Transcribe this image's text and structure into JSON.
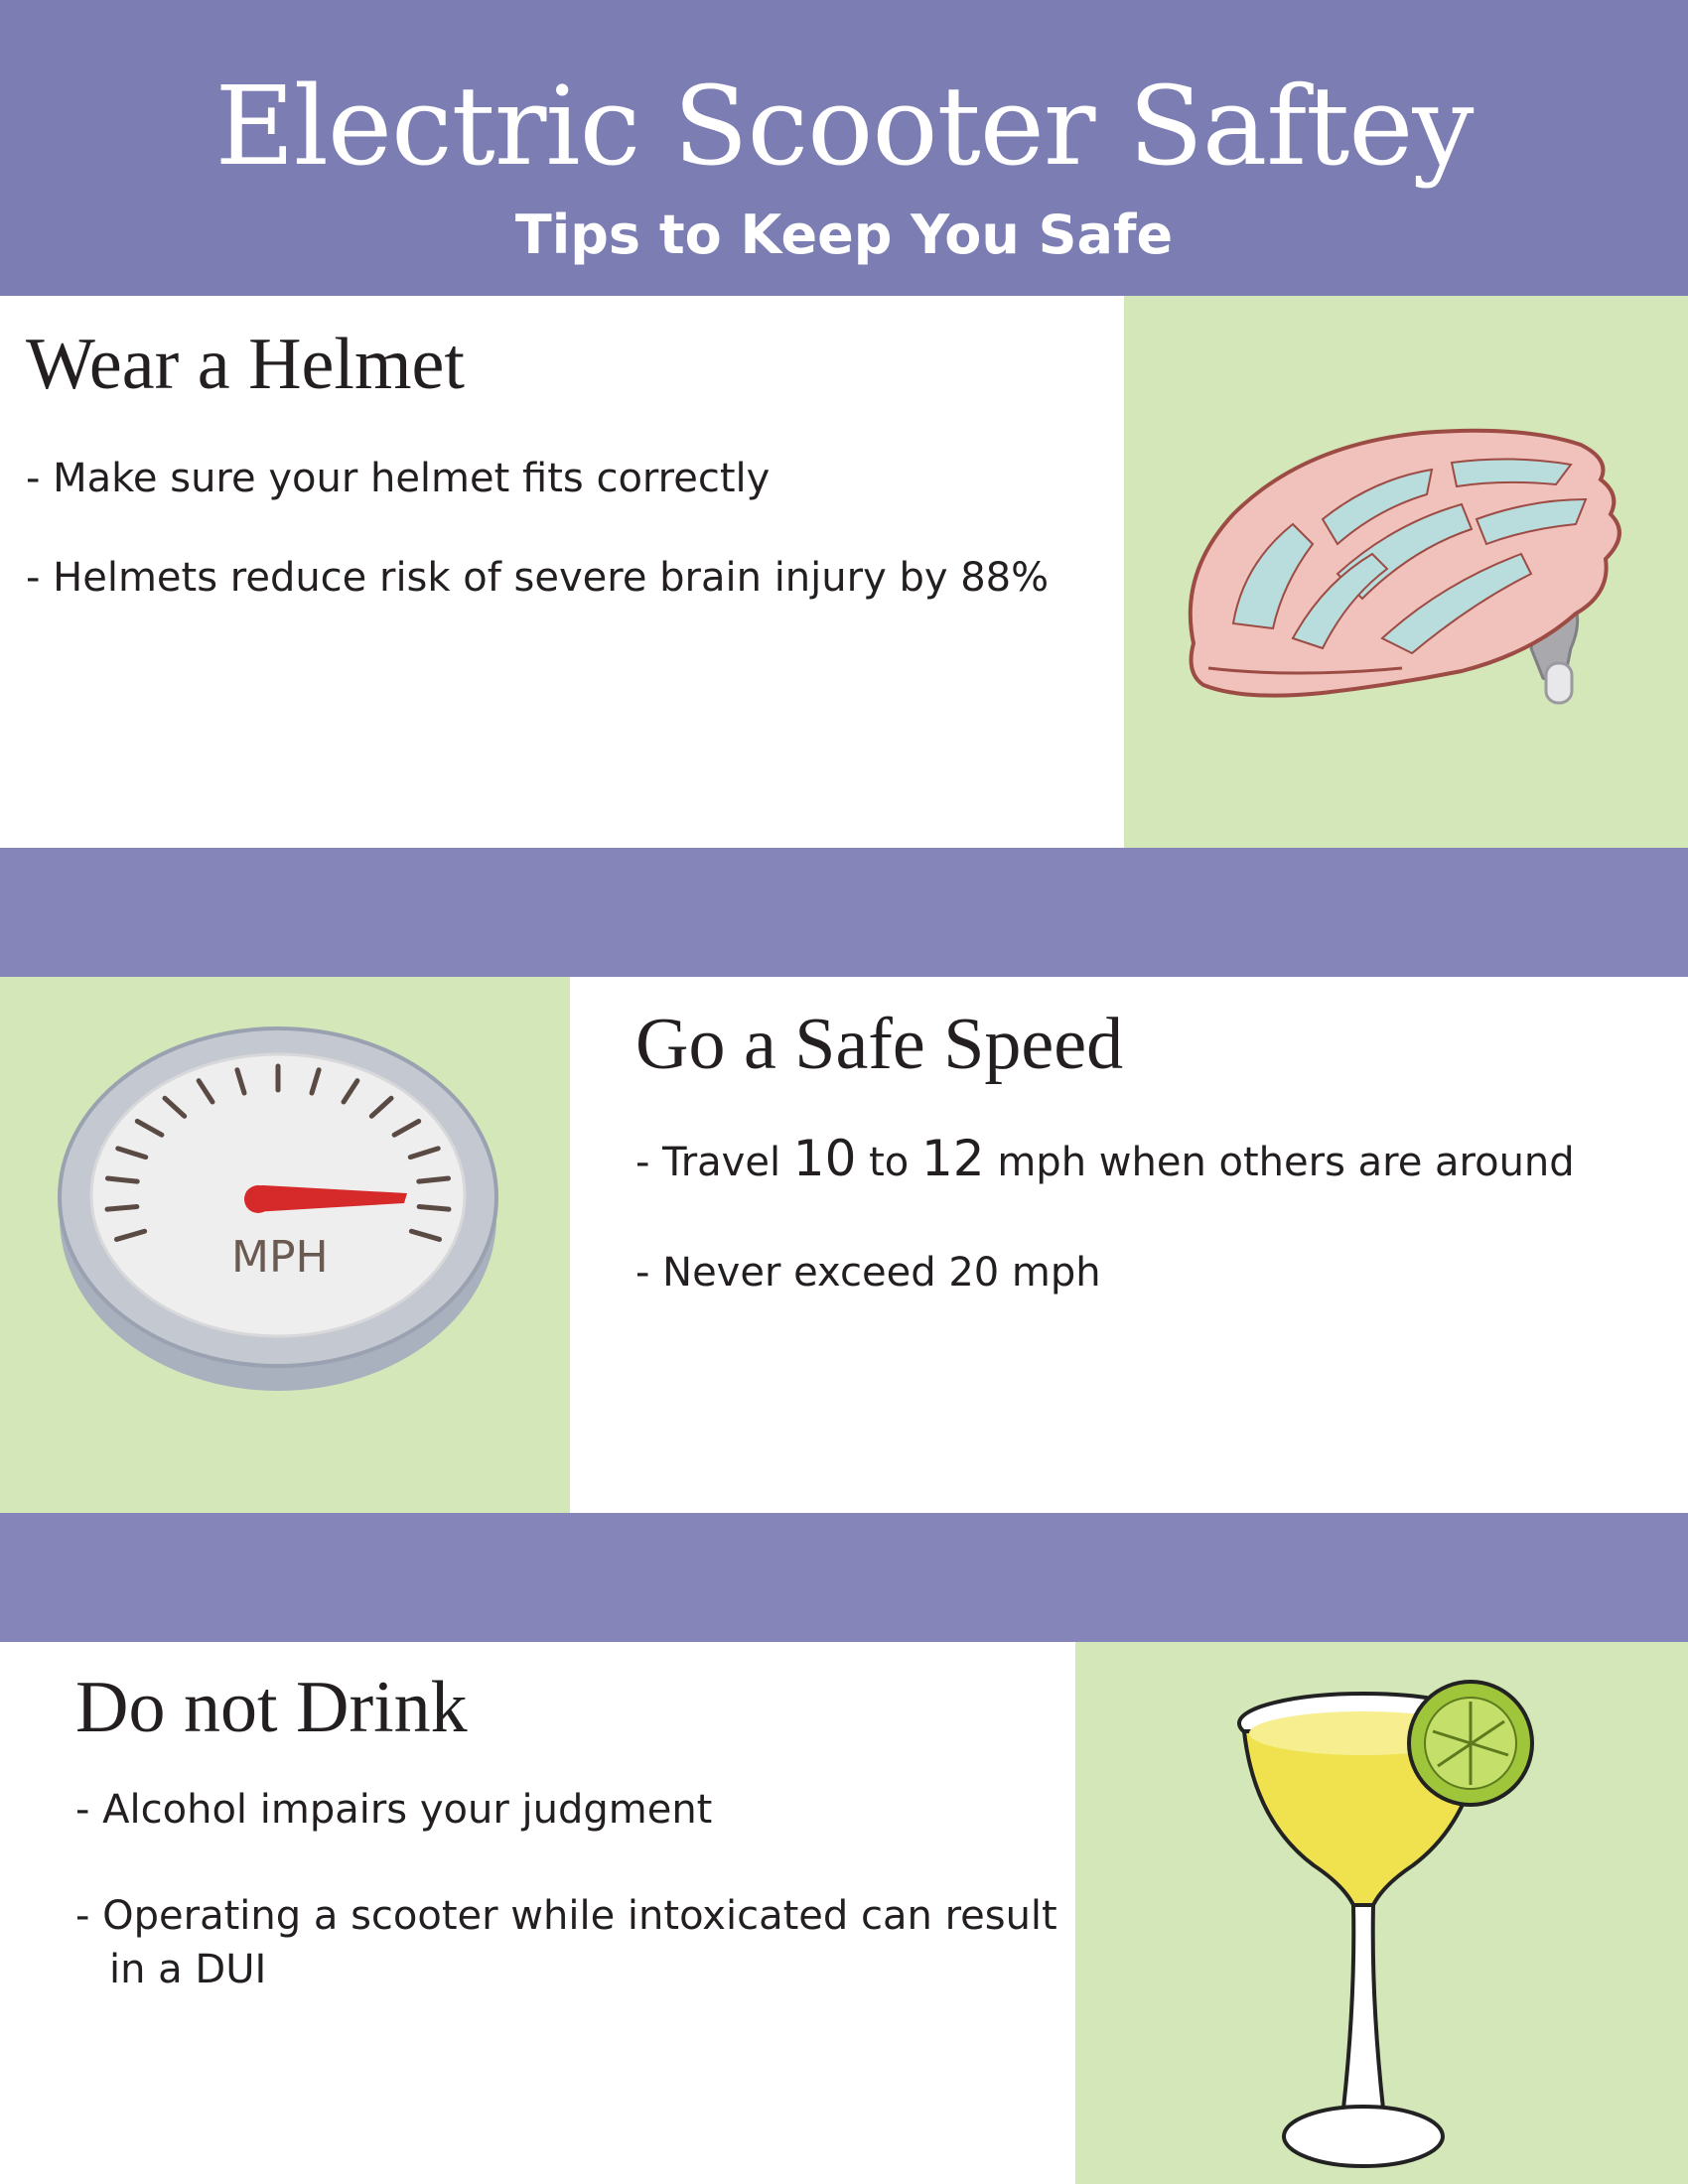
{
  "header": {
    "title": "Electric Scooter Saftey",
    "subtitle": "Tips to Keep You Safe"
  },
  "sections": [
    {
      "title": "Wear a Helmet",
      "image_icon": "helmet-icon",
      "bullets": [
        "- Make sure your helmet fits correctly",
        "- Helmets reduce risk of severe brain injury by 88%"
      ]
    },
    {
      "title": "Go a Safe Speed",
      "image_icon": "speedometer-icon",
      "image_label": "MPH",
      "bullets": [
        {
          "prefix": "- Travel ",
          "num1": "10",
          "mid": " to ",
          "num2": "12",
          "suffix": " mph when others are around"
        },
        "- Never exceed 20 mph"
      ]
    },
    {
      "title": "Do not Drink",
      "image_icon": "margarita-icon",
      "bullets": [
        "- Alcohol impairs your judgment",
        "- Operating a scooter while intoxicated can result",
        "in a DUI"
      ]
    }
  ],
  "colors": {
    "header_bg": "#7b7db3",
    "band_bg": "#8585b9",
    "panel_green": "#d3e7b8",
    "text": "#231f20"
  }
}
